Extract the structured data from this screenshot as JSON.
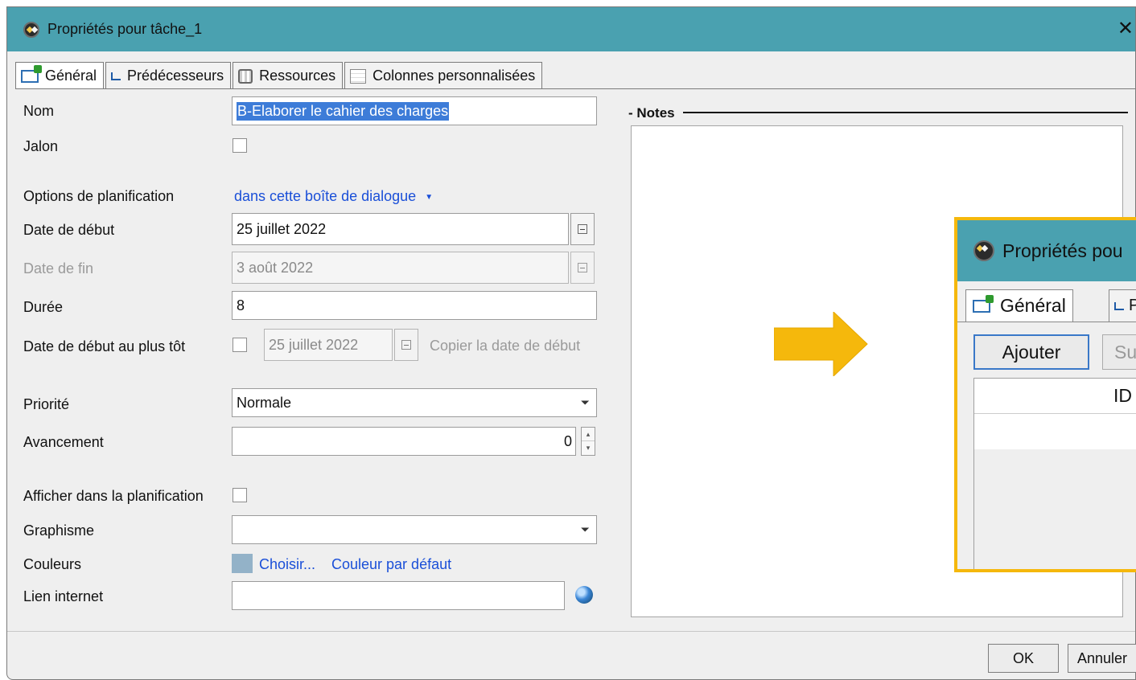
{
  "window": {
    "title": "Propriétés pour tâche_1",
    "close_glyph": "✕"
  },
  "tabs": [
    {
      "label": "Général",
      "icon": "general-icon"
    },
    {
      "label": "Prédécesseurs",
      "icon": "predecessors-icon"
    },
    {
      "label": "Ressources",
      "icon": "resources-icon"
    },
    {
      "label": "Colonnes personnalisées",
      "icon": "columns-icon"
    }
  ],
  "form": {
    "nom_label": "Nom",
    "nom_value": "B-Elaborer le cahier des charges",
    "jalon_label": "Jalon",
    "options_label": "Options de planification",
    "options_value": "dans cette boîte de dialogue",
    "options_arrow": "▼",
    "debut_label": "Date de début",
    "debut_value": "25 juillet 2022",
    "fin_label": "Date de fin",
    "fin_value": "3 août 2022",
    "duree_label": "Durée",
    "duree_value": "8",
    "tot_label": "Date de début au plus tôt",
    "tot_value": "25 juillet 2022",
    "copier_label": "Copier la date de début",
    "priorite_label": "Priorité",
    "priorite_value": "Normale",
    "avancement_label": "Avancement",
    "avancement_value": "0",
    "afficher_label": "Afficher dans la planification",
    "graphisme_label": "Graphisme",
    "graphisme_value": "",
    "couleurs_label": "Couleurs",
    "choisir_label": "Choisir...",
    "defaut_label": "Couleur par défaut",
    "swatch_color": "#93b2c8",
    "lien_label": "Lien internet",
    "lien_value": ""
  },
  "notes": {
    "label": "Notes"
  },
  "inset": {
    "title": "Propriétés pou",
    "tab_label": "Général",
    "tab2_label": "P",
    "ajouter_label": "Ajouter",
    "second_btn_label": "Su",
    "column_header": "ID"
  },
  "buttons": {
    "ok": "OK",
    "annuler": "Annuler"
  },
  "colors": {
    "titlebar": "#4aa1b0",
    "accent_arrow": "#f5b80c",
    "link": "#1a4fd8"
  }
}
